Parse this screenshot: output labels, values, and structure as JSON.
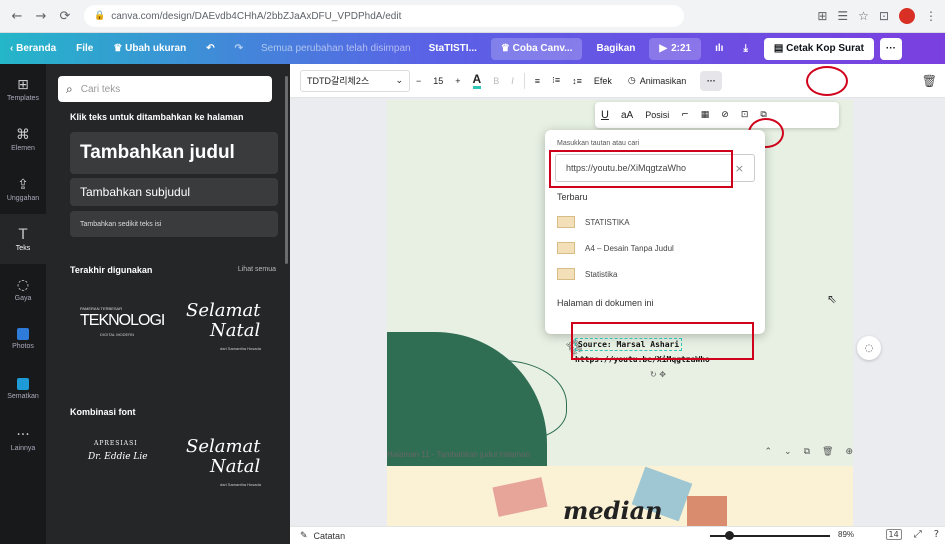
{
  "browser": {
    "url": "canva.com/design/DAEvdb4CHhA/2bbZJaAxDFU_VPDPhdA/edit",
    "nav": [
      "←",
      "→",
      "⟳"
    ],
    "right_icons": [
      "⊞",
      "☰",
      "☆",
      "⊡"
    ]
  },
  "topbar": {
    "home": "Beranda",
    "file": "File",
    "resize": "Ubah ukuran",
    "undo": "↶",
    "redo": "↷",
    "doc_title": "Semua perubahan telah disimpan",
    "project": "StaTISTI...",
    "try": "Coba Canv...",
    "share": "Bagikan",
    "present": "2:21",
    "chart": "ılı",
    "download": "⤓",
    "print": "Cetak Kop Surat",
    "more": "···"
  },
  "rail": [
    {
      "icon": "⊞",
      "label": "Templates"
    },
    {
      "icon": "⌘",
      "label": "Elemen"
    },
    {
      "icon": "⇪",
      "label": "Unggahan"
    },
    {
      "icon": "T",
      "label": "Teks"
    },
    {
      "icon": "◌",
      "label": "Gaya"
    },
    {
      "icon": "",
      "label": "Photos"
    },
    {
      "icon": "",
      "label": "Sematkan"
    },
    {
      "icon": "···",
      "label": "Lainnya"
    }
  ],
  "panel": {
    "search_placeholder": "Cari teks",
    "click_hint": "Klik teks untuk ditambahkan ke halaman",
    "add_heading": "Tambahkan judul",
    "add_subheading": "Tambahkan subjudul",
    "add_body": "Tambahkan sedikit teks isi",
    "recent": "Terakhir digunakan",
    "see_all": "Lihat semua",
    "font_combo": "Kombinasi font",
    "thumb1_small": "PAMERAN TERBESAR",
    "thumb1_big": "TEKNOLOGI",
    "thumb1_sub": "DIGITAL MODERN",
    "thumb2_a": "Selamat",
    "thumb2_b": "Natal",
    "thumb2_sub": "dari Samantha Hosada",
    "thumb3_a": "APRESIASI",
    "thumb3_b": "Dr. Eddie Lie",
    "thumb4_a": "Selamat",
    "thumb4_b": "Natal",
    "thumb4_sub": "dari Samantha Hosada"
  },
  "toolbar": {
    "font": "TDTD갈리체2스",
    "minus": "−",
    "size": "15",
    "plus": "+",
    "color_a": "A",
    "bold": "B",
    "italic": "I",
    "align": "≡",
    "list": "⁝≡",
    "spacing": "↕≡",
    "effects": "Efek",
    "animate": "Animasikan",
    "more": "···"
  },
  "sub_toolbar": {
    "underline": "U",
    "case": "aA",
    "position": "Posisi",
    "paint": "⌐",
    "transparency": "▦",
    "link": "⊘",
    "lock": "⊡",
    "copy": "⧉"
  },
  "link_popup": {
    "label": "Masukkan tautan atau cari",
    "value": "https://youtu.be/XiMqgtzaWho",
    "recent_label": "Terbaru",
    "recent_items": [
      "STATISTIKA",
      "A4 – Desain Tanpa Judul",
      "Statistika"
    ],
    "in_doc_label": "Halaman di dokumen ini"
  },
  "canvas": {
    "source_text": "Source: Marsal Ashari",
    "link_text": "https://youtu.be/XiMqgtzaWho",
    "page11_label": "Halaman 11 - Tambahkan judul halaman",
    "page11_word": "median"
  },
  "bottom": {
    "notes": "Catatan",
    "zoom": "89%",
    "zoom_level": 0.89,
    "page_count": "14"
  }
}
